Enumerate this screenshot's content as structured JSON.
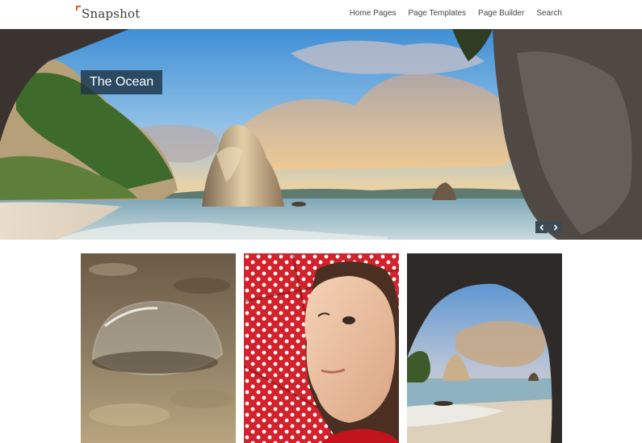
{
  "site": {
    "logo_text": "Snapshot"
  },
  "nav": {
    "items": [
      "Home Pages",
      "Page Templates",
      "Page Builder",
      "Search"
    ]
  },
  "hero": {
    "slide_title": "The Ocean",
    "prev_icon": "chevron-left-icon",
    "next_icon": "chevron-right-icon"
  },
  "gallery": {
    "items": [
      {
        "subject": "water-droplet-photo"
      },
      {
        "subject": "girl-with-umbrella-photo"
      },
      {
        "subject": "sea-arch-photo"
      }
    ]
  },
  "colors": {
    "accent": "#e05a1c",
    "caption_bg": "#1e3448",
    "control_bg": "#3b4a57"
  }
}
